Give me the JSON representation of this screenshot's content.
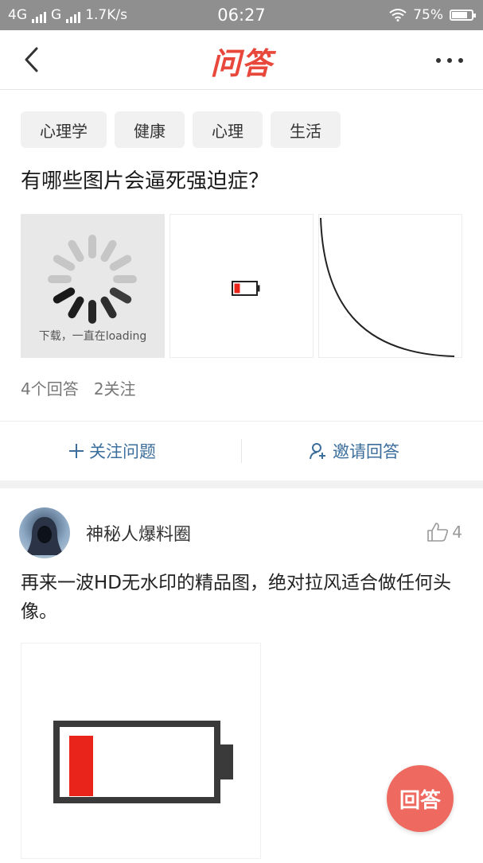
{
  "status_bar": {
    "network1": "4G",
    "network2": "G",
    "speed": "1.7K/s",
    "time": "06:27",
    "battery_percent": "75%",
    "battery_level": 0.75
  },
  "nav": {
    "title": "问答",
    "back_icon": "chevron-left-icon",
    "more_icon": "more-dots-icon"
  },
  "question": {
    "tags": [
      "心理学",
      "健康",
      "心理",
      "生活"
    ],
    "title": "有哪些图片会逼死强迫症？",
    "images": [
      {
        "caption": "下载，一直在loading",
        "icon": "loading-spinner"
      },
      {
        "icon": "low-battery-icon"
      },
      {
        "icon": "curve-line"
      }
    ],
    "answers_count": "4个回答",
    "followers_count": "2关注"
  },
  "actions": {
    "follow_label": "关注问题",
    "invite_label": "邀请回答"
  },
  "answer": {
    "author": "神秘人爆料圈",
    "likes": "4",
    "text": "再来一波HD无水印的精品图，绝对拉风适合做任何头像。",
    "image_icon": "low-battery-icon"
  },
  "fab": {
    "label": "回答"
  },
  "colors": {
    "brand": "#e8473b",
    "link": "#3c6e9c",
    "fab": "#ee6a60",
    "battery_red": "#e8241b"
  }
}
